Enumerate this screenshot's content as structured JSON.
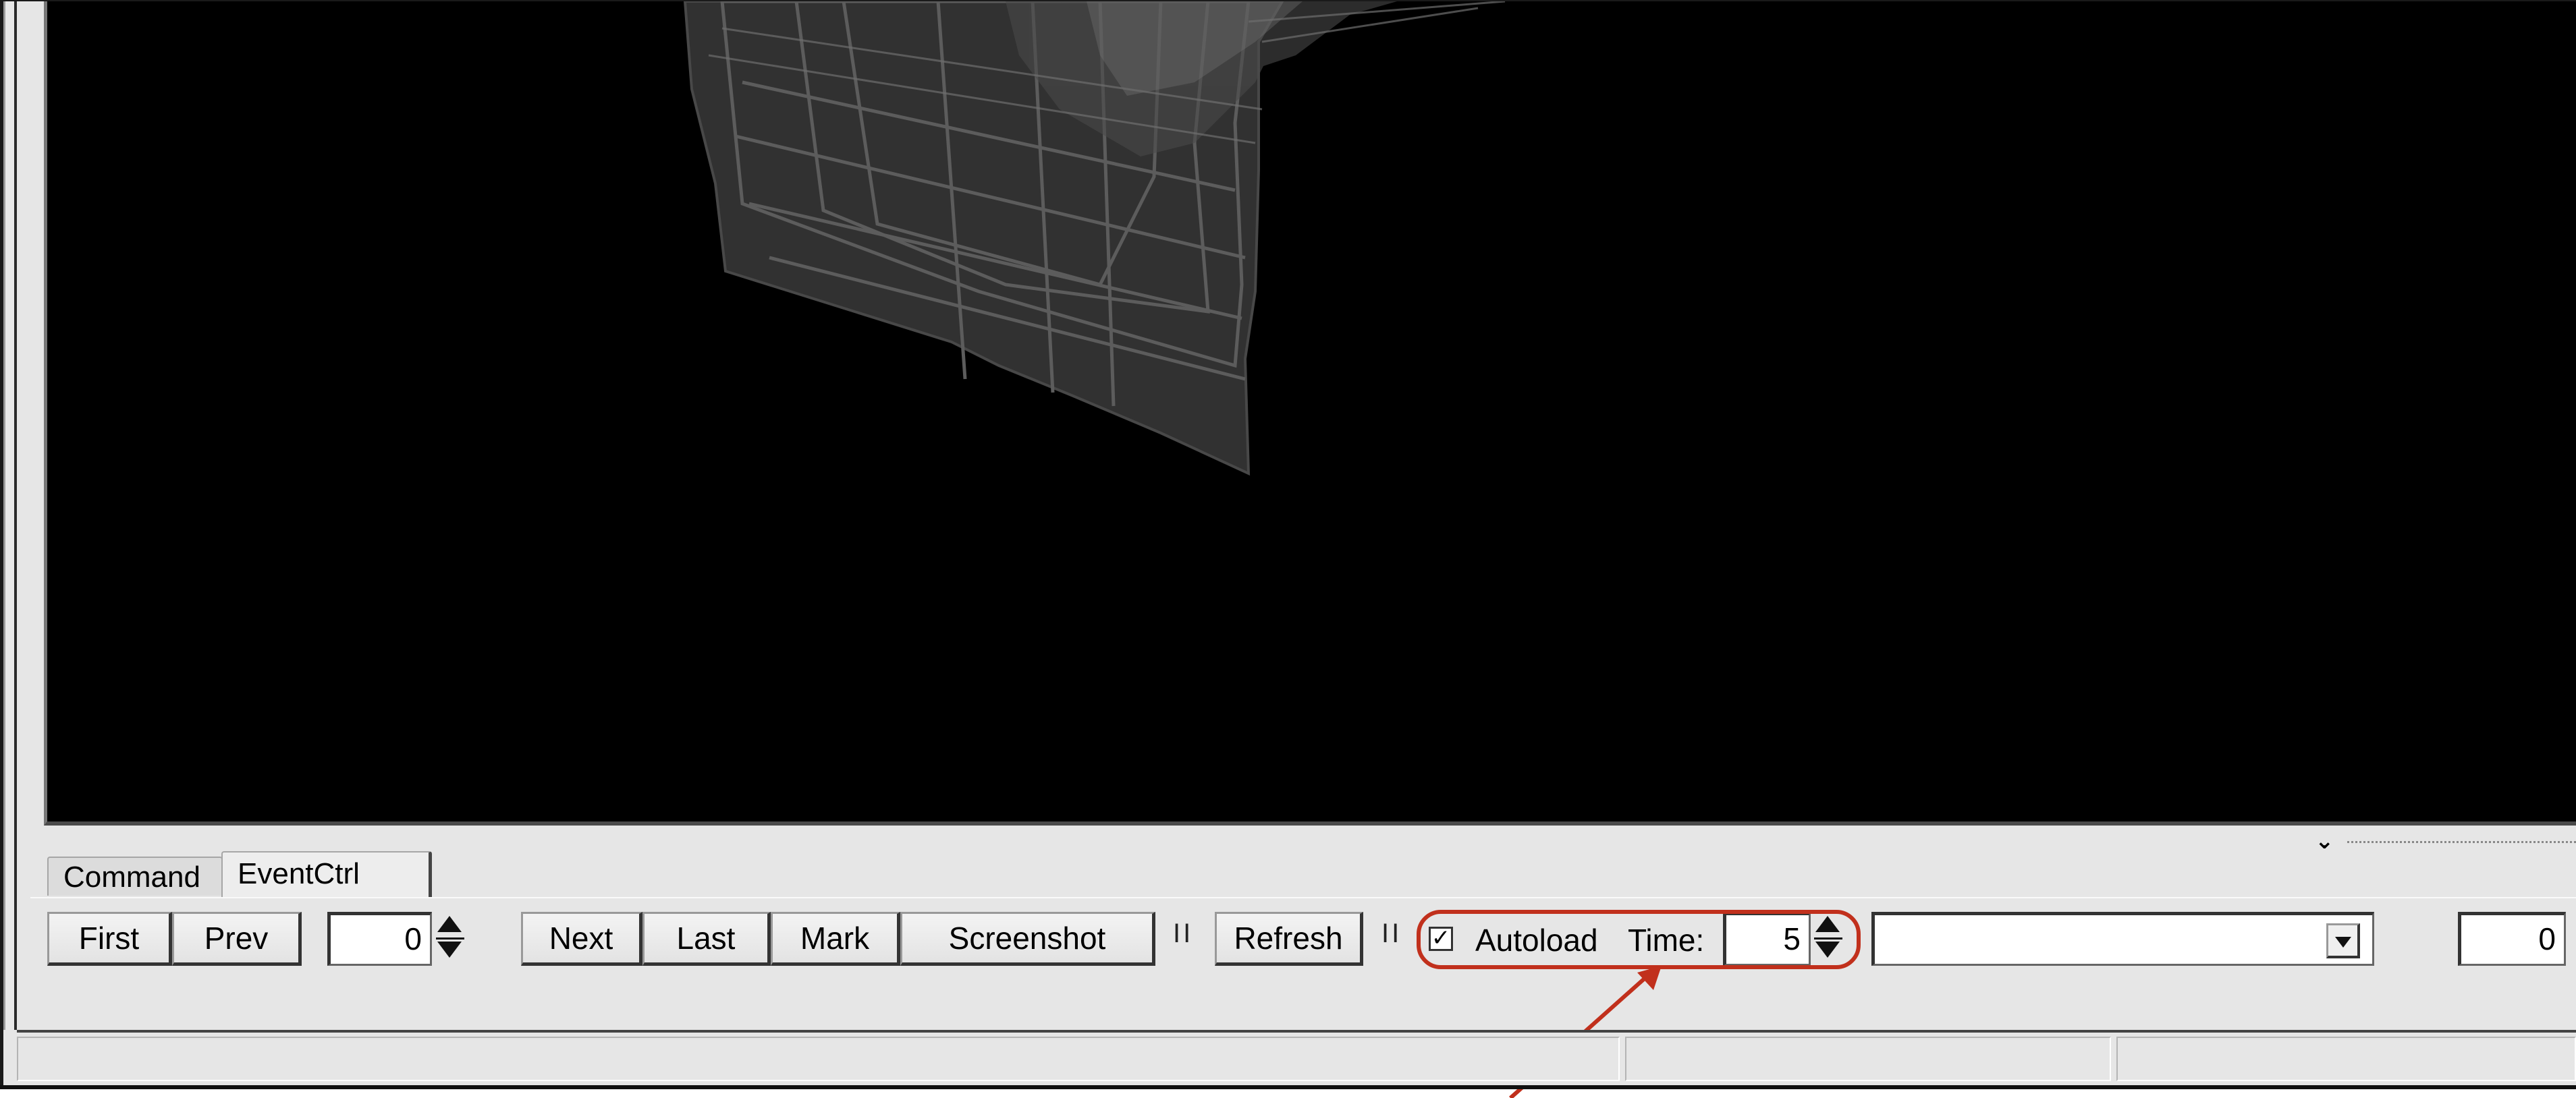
{
  "tabs": [
    {
      "label": "Command",
      "active": false
    },
    {
      "label": "EventCtrl",
      "active": true
    }
  ],
  "controls": {
    "first_label": "First",
    "prev_label": "Prev",
    "event_value": "0",
    "next_label": "Next",
    "last_label": "Last",
    "mark_label": "Mark",
    "screenshot_label": "Screenshot",
    "separator": "II",
    "refresh_label": "Refresh",
    "autoload_checked_glyph": "✓",
    "autoload_label": "Autoload",
    "time_label": "Time:",
    "time_value": "5",
    "combo_value": "",
    "right_value": "0"
  },
  "colors": {
    "viewer_background": "#000000",
    "highlight": "#c1301c",
    "panel": "#e6e6e6"
  },
  "icons": [
    "spin-up-icon",
    "spin-down-icon",
    "dropdown-arrow-icon",
    "checkbox-check-icon",
    "splitter-caret-icon"
  ]
}
